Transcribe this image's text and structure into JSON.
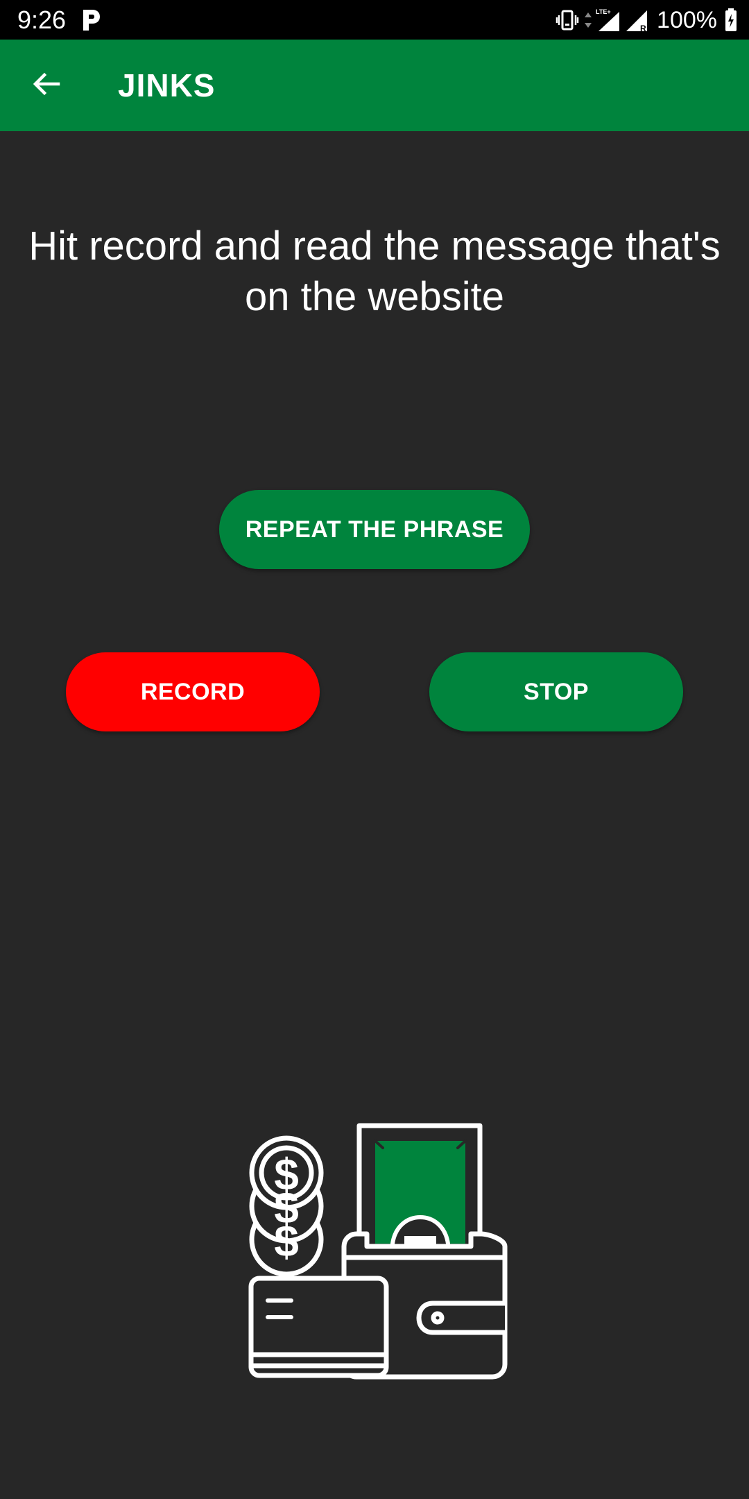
{
  "status_bar": {
    "time": "9:26",
    "battery_percent": "100%",
    "app_icon": "p-icon",
    "icons": [
      "vibrate-icon",
      "data-arrows-icon",
      "lte-signal-icon",
      "roaming-signal-icon",
      "battery-charging-icon"
    ]
  },
  "app_bar": {
    "title": "JINKS",
    "back_icon": "arrow-left-icon",
    "color": "#00843d"
  },
  "main": {
    "instruction": "Hit record and read the message that's on the website",
    "repeat_button_label": "REPEAT THE PHRASE",
    "record_button_label": "RECORD",
    "stop_button_label": "STOP",
    "illustration": "wallet-money-coins-icon"
  },
  "colors": {
    "background": "#272727",
    "accent_green": "#00843d",
    "record_red": "#ff0000",
    "text": "#ffffff"
  }
}
